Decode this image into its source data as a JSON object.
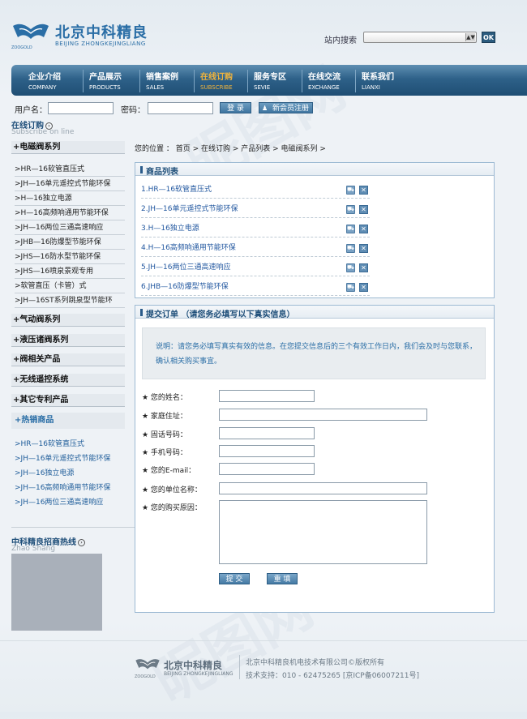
{
  "header": {
    "logo_cn": "北京中科精良",
    "logo_en": "BEIJING ZHONGKEJINGLIANG",
    "logo_mark": "ZOOGOLD",
    "search_label": "站内搜索",
    "search_button": "OK"
  },
  "nav": [
    {
      "cn": "企业介绍",
      "en": "COMPANY",
      "active": false
    },
    {
      "cn": "产品展示",
      "en": "PRODUCTS",
      "active": false
    },
    {
      "cn": "销售案例",
      "en": "SALES",
      "active": false
    },
    {
      "cn": "在线订购",
      "en": "SUBSCRIBE",
      "active": true
    },
    {
      "cn": "服务专区",
      "en": "SEVIE",
      "active": false
    },
    {
      "cn": "在线交流",
      "en": "EXCHANGE",
      "active": false
    },
    {
      "cn": "联系我们",
      "en": "LIANXI",
      "active": false
    }
  ],
  "login": {
    "username_label": "用户名：",
    "password_label": "密码：",
    "login_button": "登 录",
    "register_button": "新会员注册"
  },
  "left": {
    "title": "在线订购",
    "title_en": "Subscribe on line",
    "category_main": "+电磁阀系列",
    "sub_items": [
      ">HR—16软管直压式",
      ">JH—16单元遥控式节能环保",
      ">H—16独立电源",
      ">H—16高频响通用节能环保",
      ">JH—16两位三通高速响应",
      ">JHB—16防爆型节能环保",
      ">JHS—16防水型节能环保",
      ">JHS—16喷泉景观专用",
      ">软管直压（卡管）式",
      ">JH—16ST系列跳泉型节能环"
    ],
    "categories": [
      "+气动阀系列",
      "+液压诸阀系列",
      "+阀相关产品",
      "+无线遥控系统",
      "+其它专利产品"
    ],
    "hot_title": "+热销商品",
    "hot_items": [
      ">HR—16软管直压式",
      ">JH—16单元遥控式节能环保",
      ">JH—16独立电源",
      ">JH—16高频响通用节能环保",
      ">JH—16两位三通高速响应"
    ],
    "hotline": "中科精良招商热线",
    "hotline_en": "Zhao Shang"
  },
  "breadcrumb": "您的位置 ： 首页 > 在线订购 > 产品列表 > 电磁阀系列 >",
  "product_list": {
    "title": "商品列表",
    "items": [
      "1.HR—16软管直压式",
      "2.JH—16单元遥控式节能环保",
      "3.H—16独立电源",
      "4.H—16高频响通用节能环保",
      "5.JH—16两位三通高速响应",
      "6.JHB—16防爆型节能环保"
    ]
  },
  "order": {
    "title": "提交订单",
    "subtitle": "（请您务必填写以下真实信息）",
    "notice": "说明：请您务必填写真实有效的信息。在您提交信息后的三个有效工作日内，我们会及时与您联系，确认相关购买事宜。",
    "fields": [
      "★ 您的姓名：",
      "★ 家庭住址：",
      "★ 固话号码：",
      "★ 手机号码：",
      "★ 您的E-mail：",
      "★ 您的单位名称：",
      "★ 您的购买原因："
    ],
    "submit": "提 交",
    "reset": "重 填"
  },
  "footer": {
    "logo_cn": "北京中科精良",
    "logo_en": "BEIJING ZHONGKEJINGLIANG",
    "logo_mark": "ZOOGOLD",
    "line1": "北京中科精良机电技术有限公司©版权所有",
    "line2": "技术支持：010 - 62475265 [京ICP备06007211号]"
  },
  "colors": {
    "accent": "#1f4f7a",
    "nav": "#2e6189",
    "active": "#f1b43c",
    "link": "#2358a0"
  }
}
